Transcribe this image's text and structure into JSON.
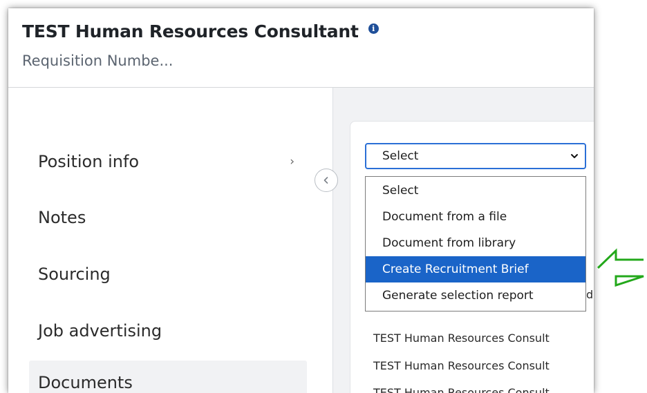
{
  "header": {
    "title": "TEST Human Resources Consultant",
    "subtitle": "Requisition Numbe..."
  },
  "sidebar": {
    "items": [
      {
        "label": "Position info",
        "has_chevron": true
      },
      {
        "label": "Notes"
      },
      {
        "label": "Sourcing"
      },
      {
        "label": "Job advertising"
      },
      {
        "label": "Documents",
        "active": true
      }
    ],
    "chevron_glyph": "›"
  },
  "documents": {
    "select": {
      "selected": "Select",
      "options": [
        "Select",
        "Document from a file",
        "Document from library",
        "Create Recruitment Brief",
        "Generate selection report"
      ],
      "highlighted": "Create Recruitment Brief"
    },
    "list": [
      "TEST Human Resources Consult",
      "TEST Human Resources Consult",
      "TEST Human Resources Consult"
    ],
    "peek_text": "d"
  },
  "icons": {
    "info": "info-icon",
    "collapse": "chevron-left-icon",
    "dropdown": "chevron-down-icon",
    "annotation": "green-left-arrow-icon"
  },
  "colors": {
    "accent": "#2a6fd6",
    "highlight": "#1a64c8",
    "annotation": "#23a81b"
  }
}
